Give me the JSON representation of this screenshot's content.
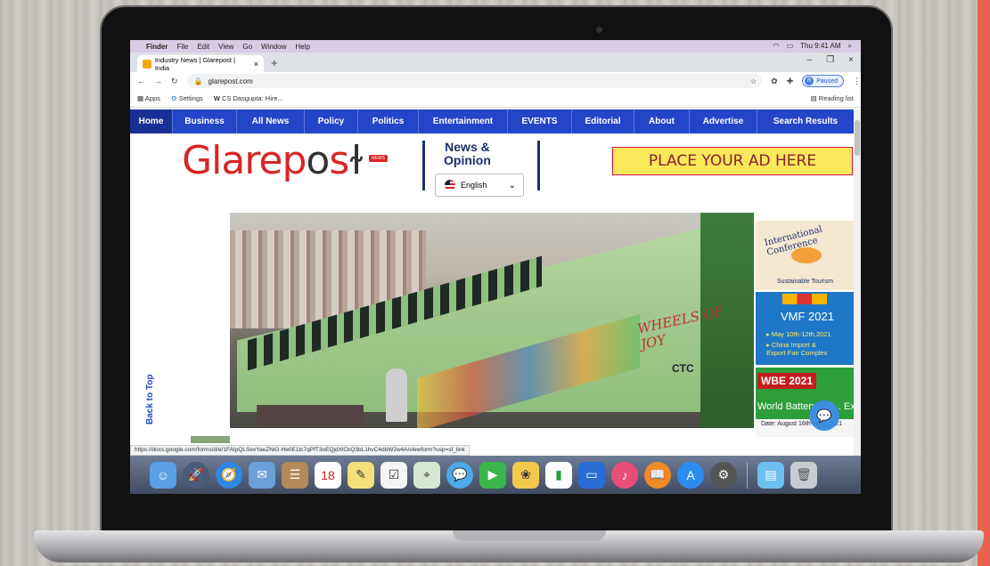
{
  "mac_menubar": {
    "items": [
      "Finder",
      "File",
      "Edit",
      "View",
      "Go",
      "Window",
      "Help"
    ],
    "clock": "Thu 9:41 AM"
  },
  "browser": {
    "tab_title": "Industry News | Glarepost | India",
    "url": "glarepost.com",
    "profile_initial": "R",
    "profile_status": "Paused",
    "bookmarks": [
      "Apps",
      "Settings",
      "CS Dasgupta: Hire..."
    ],
    "reading_list": "Reading list",
    "status_url": "https://docs.google.com/forms/d/e/1FAIpQLSexYaeZNiG-He0E1tc7qPfT3oEQjdXlCkQ3bL1hvC4dbW2w4A/viewform?usp=sf_link"
  },
  "site": {
    "nav": [
      "Home",
      "Business",
      "All News",
      "Policy",
      "Politics",
      "Entertainment",
      "EVENTS",
      "Editorial",
      "About",
      "Advertise",
      "Search Results"
    ],
    "logo_main": "Glarep",
    "logo_o": "o",
    "logo_end": "s",
    "logo_badge": "NEWS",
    "tagline_line1": "News &",
    "tagline_line2": "Opinion",
    "language": "English",
    "ad_banner": "PLACE YOUR AD HERE",
    "hero_caption": "WHEELS OF JOY",
    "hero_ctc": "CTC",
    "back_to_top": "Back to Top"
  },
  "side_ads": {
    "conference_title": "International Conference",
    "conference_sub": "Sustainable Tourism",
    "vmf_title": "VMF 2021",
    "vmf_line1": "▸ May 10th-12th,2021",
    "vmf_line2": "▸ China Import &",
    "vmf_line3": "  Export Fair Complex",
    "wbe_badge": "WBE 2021",
    "wbe_title": "World Battery Ind... Expo",
    "wbe_date": "Date: August 16th-18th, 2021"
  }
}
